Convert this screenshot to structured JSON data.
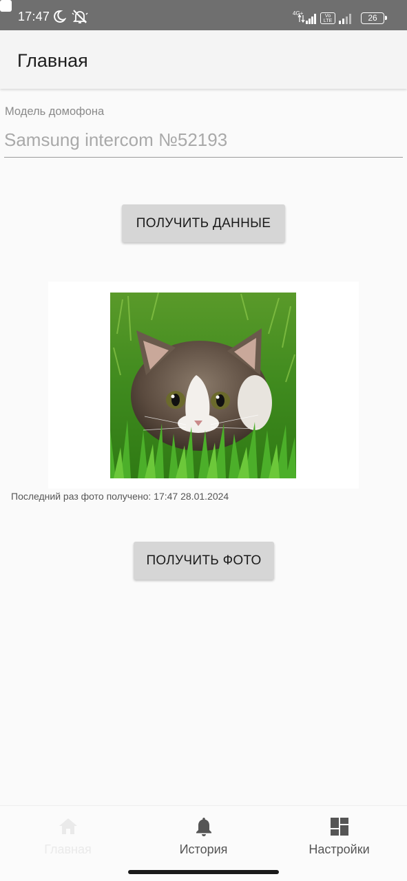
{
  "status_bar": {
    "time": "17:47",
    "network": "4G+",
    "volte": "Vo LTE",
    "battery": "26",
    "icons": [
      "moon-icon",
      "bell-off-icon",
      "square-notification-icon",
      "signal-icon",
      "signal-icon",
      "battery-icon"
    ]
  },
  "app_bar": {
    "title": "Главная"
  },
  "intercom": {
    "label": "Модель домофона",
    "value": "Samsung intercom №52193"
  },
  "buttons": {
    "get_data": "ПОЛУЧИТЬ ДАННЫЕ",
    "get_photo": "ПОЛУЧИТЬ ФОТО"
  },
  "photo": {
    "caption": "Последний раз фото получено: 17:47 28.01.2024",
    "subject": "kitten-in-grass"
  },
  "bottom_nav": {
    "items": [
      {
        "label": "Главная",
        "icon": "home-icon",
        "active": true
      },
      {
        "label": "История",
        "icon": "bell-icon",
        "active": false
      },
      {
        "label": "Настройки",
        "icon": "dashboard-icon",
        "active": false
      }
    ]
  },
  "colors": {
    "status_bar": "#6f6f6f",
    "app_bar": "#f4f4f4",
    "button": "#d6d6d6",
    "background": "#fafafa",
    "active_nav": "#eaeaea"
  }
}
